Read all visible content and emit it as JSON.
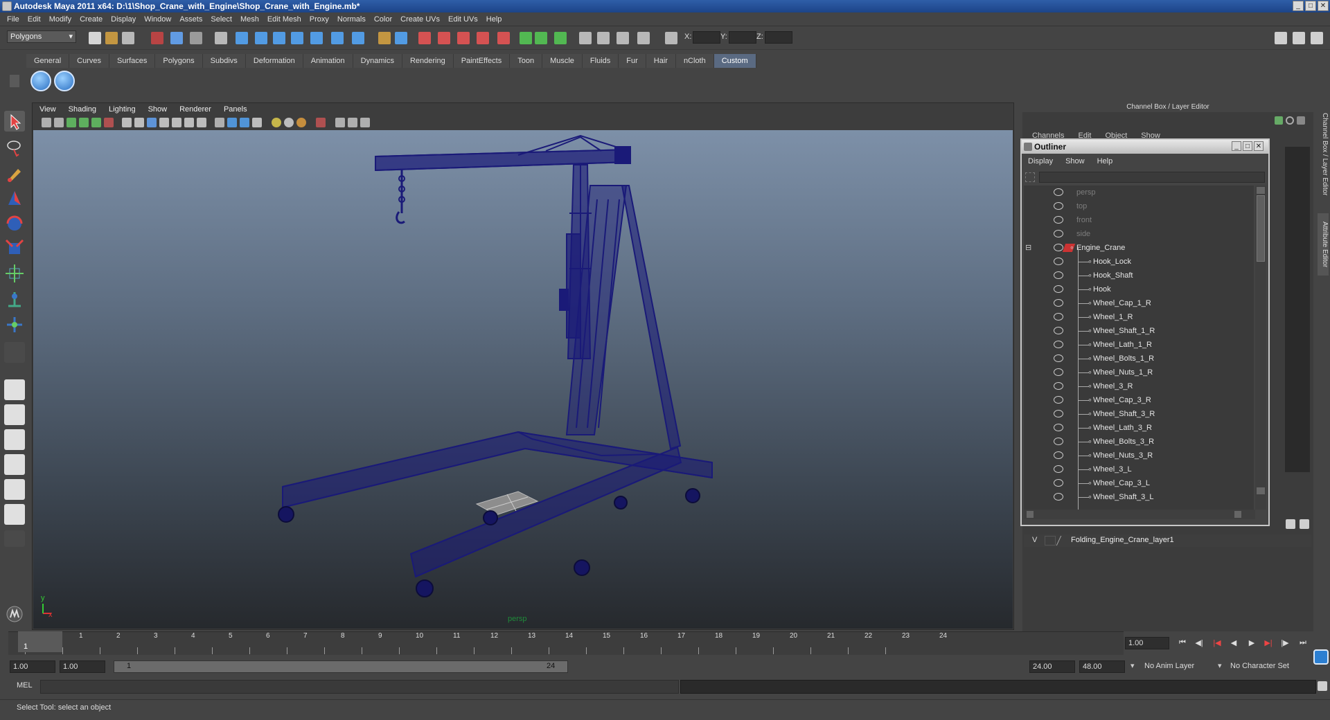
{
  "window": {
    "title": "Autodesk Maya 2011 x64: D:\\1\\Shop_Crane_with_Engine\\Shop_Crane_with_Engine.mb*"
  },
  "menubar": [
    "File",
    "Edit",
    "Modify",
    "Create",
    "Display",
    "Window",
    "Assets",
    "Select",
    "Mesh",
    "Edit Mesh",
    "Proxy",
    "Normals",
    "Color",
    "Create UVs",
    "Edit UVs",
    "Help"
  ],
  "statusline": {
    "mode": "Polygons",
    "x_label": "X:",
    "y_label": "Y:",
    "z_label": "Z:"
  },
  "shelf": {
    "tabs": [
      "General",
      "Curves",
      "Surfaces",
      "Polygons",
      "Subdivs",
      "Deformation",
      "Animation",
      "Dynamics",
      "Rendering",
      "PaintEffects",
      "Toon",
      "Muscle",
      "Fluids",
      "Fur",
      "Hair",
      "nCloth",
      "Custom"
    ],
    "active": "Custom"
  },
  "viewport": {
    "menu": [
      "View",
      "Shading",
      "Lighting",
      "Show",
      "Renderer",
      "Panels"
    ],
    "camera_label": "persp",
    "axis_x": "x",
    "axis_y": "y",
    "wire_color": "#1a1a78"
  },
  "channel_box": {
    "header": "Channel Box / Layer Editor",
    "menu": [
      "Channels",
      "Edit",
      "Object",
      "Show"
    ],
    "side_tabs": [
      "Channel Box / Layer Editor",
      "Attribute Editor"
    ]
  },
  "outliner": {
    "title": "Outliner",
    "menu": [
      "Display",
      "Show",
      "Help"
    ],
    "items": [
      {
        "label": "persp",
        "dim": true,
        "indent": 0
      },
      {
        "label": "top",
        "dim": true,
        "indent": 0
      },
      {
        "label": "front",
        "dim": true,
        "indent": 0
      },
      {
        "label": "side",
        "dim": true,
        "indent": 0
      },
      {
        "label": "Engine_Crane",
        "dim": false,
        "indent": 0,
        "group": true
      },
      {
        "label": "Hook_Lock",
        "dim": false,
        "indent": 1
      },
      {
        "label": "Hook_Shaft",
        "dim": false,
        "indent": 1
      },
      {
        "label": "Hook",
        "dim": false,
        "indent": 1
      },
      {
        "label": "Wheel_Cap_1_R",
        "dim": false,
        "indent": 1
      },
      {
        "label": "Wheel_1_R",
        "dim": false,
        "indent": 1
      },
      {
        "label": "Wheel_Shaft_1_R",
        "dim": false,
        "indent": 1
      },
      {
        "label": "Wheel_Lath_1_R",
        "dim": false,
        "indent": 1
      },
      {
        "label": "Wheel_Bolts_1_R",
        "dim": false,
        "indent": 1
      },
      {
        "label": "Wheel_Nuts_1_R",
        "dim": false,
        "indent": 1
      },
      {
        "label": "Wheel_3_R",
        "dim": false,
        "indent": 1
      },
      {
        "label": "Wheel_Cap_3_R",
        "dim": false,
        "indent": 1
      },
      {
        "label": "Wheel_Shaft_3_R",
        "dim": false,
        "indent": 1
      },
      {
        "label": "Wheel_Lath_3_R",
        "dim": false,
        "indent": 1
      },
      {
        "label": "Wheel_Bolts_3_R",
        "dim": false,
        "indent": 1
      },
      {
        "label": "Wheel_Nuts_3_R",
        "dim": false,
        "indent": 1
      },
      {
        "label": "Wheel_3_L",
        "dim": false,
        "indent": 1
      },
      {
        "label": "Wheel_Cap_3_L",
        "dim": false,
        "indent": 1
      },
      {
        "label": "Wheel_Shaft_3_L",
        "dim": false,
        "indent": 1
      }
    ]
  },
  "layer_editor": {
    "visible_flag": "V",
    "layer_name": "Folding_Engine_Crane_layer1"
  },
  "timeline": {
    "ticks": [
      "1",
      "2",
      "3",
      "4",
      "5",
      "6",
      "7",
      "8",
      "9",
      "10",
      "11",
      "12",
      "13",
      "14",
      "15",
      "16",
      "17",
      "18",
      "19",
      "20",
      "21",
      "22",
      "23",
      "24"
    ],
    "current_frame": "1.00",
    "current_marker": "1"
  },
  "range": {
    "start_time": "1.00",
    "playback_start": "1.00",
    "slider_start": "1",
    "slider_end": "24",
    "playback_end": "24.00",
    "end_time": "48.00",
    "anim_layer": "No Anim Layer",
    "character_set": "No Character Set"
  },
  "cmdline": {
    "label": "MEL"
  },
  "help_line": {
    "text": "Select Tool: select an object"
  }
}
